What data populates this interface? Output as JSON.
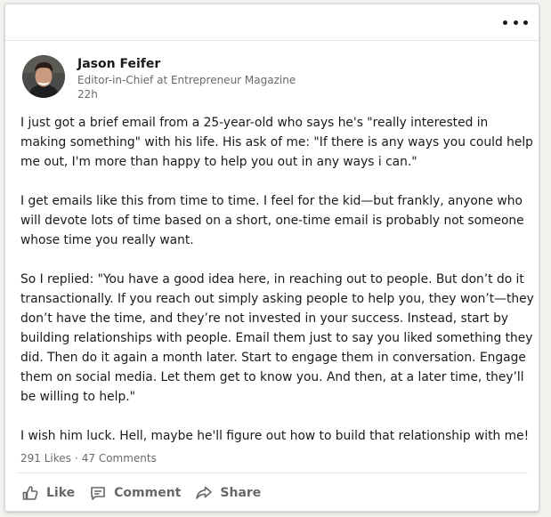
{
  "post": {
    "author": {
      "name": "Jason Feifer",
      "headline": "Editor-in-Chief at Entrepreneur Magazine",
      "time": "22h"
    },
    "paragraphs": [
      "I just got a brief email from a 25-year-old who says he's \"really interested in making something\" with his life. His ask of me: \"If there is any ways you could help me out, I'm more than happy to help you out in any ways i can.\"",
      "I get emails like this from time to time. I feel for the kid—but frankly, anyone who will devote lots of time based on a short, one-time email is probably not someone whose time you really want.",
      "So I replied: \"You have a good idea here, in reaching out to people. But don’t do it transactionally. If you reach out simply asking people to help you, they won’t—they don’t have the time, and they’re not invested in your success. Instead, start by building relationships with people. Email them just to say you liked something they did. Then do it again a month later. Start to engage them in conversation. Engage them on social media. Let them get to know you. And then, at a later time, they’ll be willing to help.\"",
      "I wish him luck. Hell, maybe he'll figure out how to build that relationship with me!"
    ],
    "social": {
      "likes": "291 Likes",
      "separator": "·",
      "comments": "47 Comments"
    },
    "actions": {
      "like": "Like",
      "comment": "Comment",
      "share": "Share"
    }
  },
  "icons": {
    "menu": "more-horizontal-icon",
    "like": "thumbs-up-icon",
    "comment": "comment-icon",
    "share": "share-arrow-icon"
  },
  "colors": {
    "card_background": "#ffffff",
    "page_background": "#f3f2ef",
    "secondary_text": "#666666",
    "icon_color": "#666666"
  }
}
